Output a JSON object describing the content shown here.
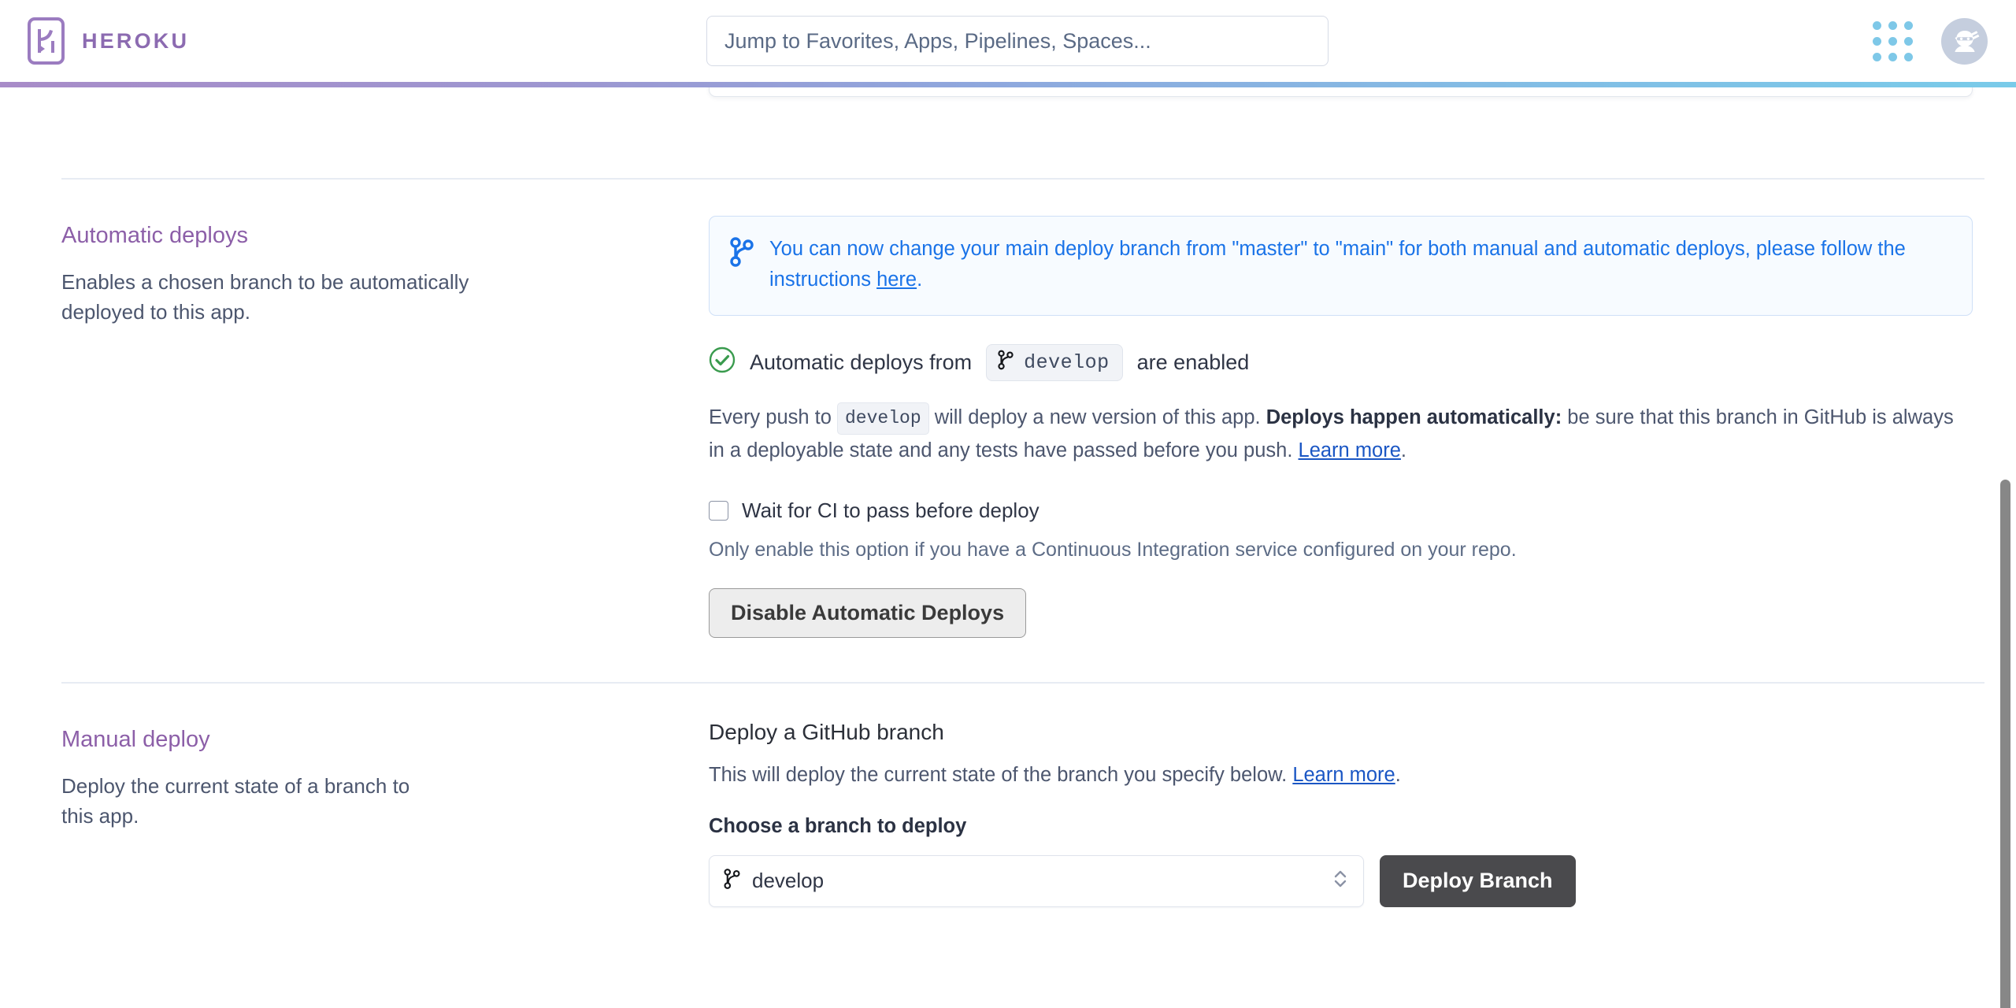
{
  "header": {
    "brand": "HEROKU",
    "logo_icon": "heroku-logo-icon",
    "search_placeholder": "Jump to Favorites, Apps, Pipelines, Spaces...",
    "search_value": "",
    "app_grid_icon": "app-grid-icon",
    "avatar_icon": "ninja-avatar-icon"
  },
  "automatic_deploys": {
    "title": "Automatic deploys",
    "description": "Enables a chosen branch to be automatically deployed to this app.",
    "banner": {
      "icon": "git-branch-icon",
      "text_before": "You can now change your main deploy branch from \"master\" to \"main\" for both manual and automatic deploys, please follow the instructions ",
      "link": "here",
      "text_after": "."
    },
    "status": {
      "icon": "check-circle-icon",
      "prefix": "Automatic deploys from",
      "branch": "develop",
      "branch_icon": "git-branch-icon",
      "suffix": "are enabled"
    },
    "detail": {
      "p1": "Every push to ",
      "branch_chip": "develop",
      "p2": " will deploy a new version of this app. ",
      "bold": "Deploys happen automatically:",
      "p3": " be sure that this branch in GitHub is always in a deployable state and any tests have passed before you push. ",
      "link": "Learn more",
      "p4": "."
    },
    "ci_checkbox_label": "Wait for CI to pass before deploy",
    "ci_checked": false,
    "ci_hint": "Only enable this option if you have a Continuous Integration service configured on your repo.",
    "disable_button": "Disable Automatic Deploys"
  },
  "manual_deploy": {
    "title": "Manual deploy",
    "description": "Deploy the current state of a branch to this app.",
    "sub_title": "Deploy a GitHub branch",
    "sub_desc_before": "This will deploy the current state of the branch you specify below. ",
    "sub_desc_link": "Learn more",
    "sub_desc_after": ".",
    "field_label": "Choose a branch to deploy",
    "selected_branch": "develop",
    "branch_icon": "git-branch-icon",
    "chevron_icon": "chevron-up-down-icon",
    "deploy_button": "Deploy Branch"
  },
  "colors": {
    "brand_purple": "#8c6bb1",
    "section_title": "#8c5fa8",
    "link_blue": "#1a73e8",
    "banner_bg": "#f7fbff",
    "banner_border": "#cfe0f7",
    "success_green": "#3a9b4e",
    "dark_button": "#4a4a4d",
    "grid_dot": "#7ec8e8",
    "gradient_from": "#a88cc8",
    "gradient_to": "#79cbe9"
  }
}
